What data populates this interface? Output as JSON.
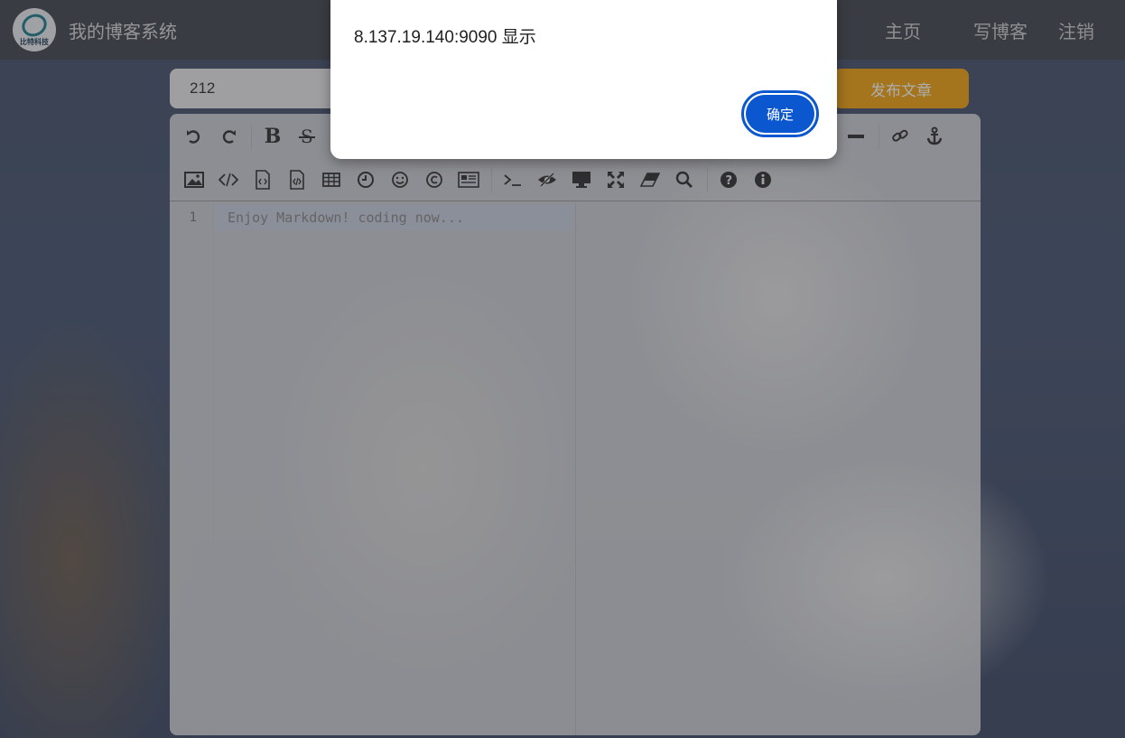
{
  "navbar": {
    "logo_text": "比特科技",
    "site_title": "我的博客系统",
    "links": [
      "主页",
      "写博客",
      "注销"
    ]
  },
  "editor_form": {
    "title_value": "212",
    "publish_label": "发布文章"
  },
  "editor": {
    "line_number": "1",
    "placeholder": "Enjoy Markdown! coding now..."
  },
  "dialog": {
    "message": "8.137.19.140:9090 显示",
    "ok_label": "确定"
  },
  "colors": {
    "publish_button": "#f2a516",
    "dialog_button": "#0b57d0"
  }
}
